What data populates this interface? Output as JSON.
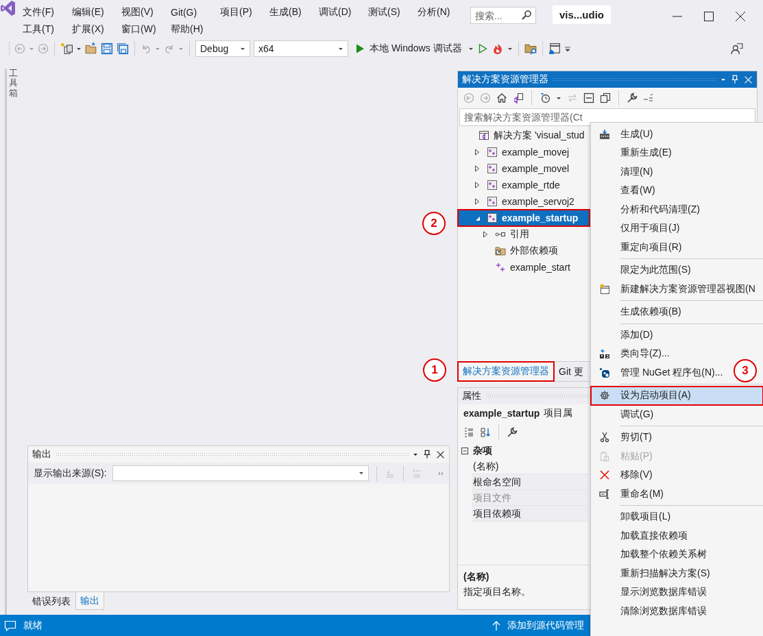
{
  "window": {
    "search": {
      "placeholder": "搜索..."
    },
    "title": "vis...udio"
  },
  "menu_bar": {
    "rows": [
      [
        "文件(F)",
        "编辑(E)",
        "视图(V)",
        "Git(G)",
        "项目(P)",
        "生成(B)",
        "调试(D)",
        "测试(S)",
        "分析(N)"
      ],
      [
        "工具(T)",
        "扩展(X)",
        "窗口(W)",
        "帮助(H)"
      ]
    ]
  },
  "toolbar": {
    "configuration": "Debug",
    "platform": "x64",
    "run_label": "本地 Windows 调试器"
  },
  "toolbox": {
    "label": "工具箱"
  },
  "solution_explorer": {
    "title": "解决方案资源管理器",
    "search": {
      "placeholder": "搜索解决方案资源管理器(Ct"
    },
    "tree": [
      {
        "kind": "solution",
        "label": "解决方案 'visual_stud",
        "selected": false,
        "boxed": false,
        "children": [
          {
            "kind": "project",
            "label": "example_movej",
            "expanded": false,
            "selected": false,
            "boxed": false
          },
          {
            "kind": "project",
            "label": "example_movel",
            "expanded": false,
            "selected": false,
            "boxed": false
          },
          {
            "kind": "project",
            "label": "example_rtde",
            "expanded": false,
            "selected": false,
            "boxed": false
          },
          {
            "kind": "project",
            "label": "example_servoj2",
            "expanded": false,
            "selected": false,
            "boxed": false
          },
          {
            "kind": "project",
            "label": "example_startup",
            "expanded": true,
            "selected": true,
            "boxed": true,
            "children": [
              {
                "kind": "references",
                "label": "引用",
                "expanded": false,
                "selected": false,
                "boxed": false
              },
              {
                "kind": "external",
                "label": "外部依赖项",
                "selected": false,
                "boxed": false
              },
              {
                "kind": "file",
                "label": "example_start",
                "selected": false,
                "boxed": false
              }
            ]
          }
        ]
      }
    ],
    "tabs": [
      {
        "label": "解决方案资源管理器",
        "selected": true,
        "boxed": true
      },
      {
        "label": "Git 更",
        "selected": false,
        "boxed": false
      }
    ]
  },
  "properties": {
    "title": "属性",
    "object_name": "example_startup",
    "object_type": "项目属",
    "category": {
      "label": "杂项",
      "expanded": true,
      "rows": [
        {
          "label": "(名称)",
          "selected": true,
          "disabled": false
        },
        {
          "label": "根命名空间",
          "selected": false,
          "disabled": false
        },
        {
          "label": "项目文件",
          "selected": false,
          "disabled": true
        },
        {
          "label": "项目依赖项",
          "selected": false,
          "disabled": false
        }
      ]
    },
    "description": {
      "title": "(名称)",
      "text": "指定项目名称。"
    }
  },
  "output": {
    "title": "输出",
    "source_label": "显示输出来源(S):",
    "tabs": [
      {
        "label": "错误列表",
        "selected": false
      },
      {
        "label": "输出",
        "selected": true
      }
    ]
  },
  "status_bar": {
    "text": "就绪",
    "source_control": "添加到源代码管理"
  },
  "context_menu": {
    "groups": [
      {
        "items": [
          {
            "kind": "build",
            "label": "生成(U)",
            "selected": false,
            "disabled": false,
            "boxed": false
          },
          {
            "kind": "plain",
            "label": "重新生成(E)",
            "selected": false,
            "disabled": false,
            "boxed": false
          },
          {
            "kind": "plain",
            "label": "清理(N)",
            "selected": false,
            "disabled": false,
            "boxed": false
          },
          {
            "kind": "plain",
            "label": "查看(W)",
            "selected": false,
            "disabled": false,
            "boxed": false
          },
          {
            "kind": "plain",
            "label": "分析和代码清理(Z)",
            "selected": false,
            "disabled": false,
            "boxed": false
          },
          {
            "kind": "plain",
            "label": "仅用于项目(J)",
            "selected": false,
            "disabled": false,
            "boxed": false
          },
          {
            "kind": "plain",
            "label": "重定向项目(R)",
            "selected": false,
            "disabled": false,
            "boxed": false
          }
        ]
      },
      {
        "items": [
          {
            "kind": "plain",
            "label": "限定为此范围(S)",
            "selected": false,
            "disabled": false,
            "boxed": false
          },
          {
            "kind": "view",
            "label": "新建解决方案资源管理器视图(N",
            "selected": false,
            "disabled": false,
            "boxed": false
          }
        ]
      },
      {
        "items": [
          {
            "kind": "plain",
            "label": "生成依赖项(B)",
            "selected": false,
            "disabled": false,
            "boxed": false
          }
        ]
      },
      {
        "items": [
          {
            "kind": "plain",
            "label": "添加(D)",
            "selected": false,
            "disabled": false,
            "boxed": false
          },
          {
            "kind": "wizard",
            "label": "类向导(Z)...",
            "selected": false,
            "disabled": false,
            "boxed": false
          },
          {
            "kind": "nuget",
            "label": "管理 NuGet 程序包(N)...",
            "selected": false,
            "disabled": false,
            "boxed": false
          }
        ]
      },
      {
        "items": [
          {
            "kind": "settings",
            "label": "设为启动项目(A)",
            "selected": true,
            "disabled": false,
            "boxed": true
          },
          {
            "kind": "plain",
            "label": "调试(G)",
            "selected": false,
            "disabled": false,
            "boxed": false
          }
        ]
      },
      {
        "items": [
          {
            "kind": "cut",
            "label": "剪切(T)",
            "selected": false,
            "disabled": false,
            "boxed": false
          },
          {
            "kind": "paste",
            "label": "粘贴(P)",
            "selected": false,
            "disabled": true,
            "boxed": false
          },
          {
            "kind": "remove",
            "label": "移除(V)",
            "selected": false,
            "disabled": false,
            "boxed": false
          },
          {
            "kind": "rename",
            "label": "重命名(M)",
            "selected": false,
            "disabled": false,
            "boxed": false
          }
        ]
      },
      {
        "items": [
          {
            "kind": "plain",
            "label": "卸载项目(L)",
            "selected": false,
            "disabled": false,
            "boxed": false
          },
          {
            "kind": "plain",
            "label": "加载直接依赖项",
            "selected": false,
            "disabled": false,
            "boxed": false
          },
          {
            "kind": "plain",
            "label": "加载整个依赖关系树",
            "selected": false,
            "disabled": false,
            "boxed": false
          },
          {
            "kind": "plain",
            "label": "重新扫描解决方案(S)",
            "selected": false,
            "disabled": false,
            "boxed": false
          },
          {
            "kind": "plain",
            "label": "显示浏览数据库错误",
            "selected": false,
            "disabled": false,
            "boxed": false
          },
          {
            "kind": "plain",
            "label": "清除浏览数据库错误",
            "selected": false,
            "disabled": false,
            "boxed": false
          }
        ]
      }
    ]
  },
  "annotations": [
    {
      "number": "1"
    },
    {
      "number": "2"
    },
    {
      "number": "3"
    }
  ]
}
